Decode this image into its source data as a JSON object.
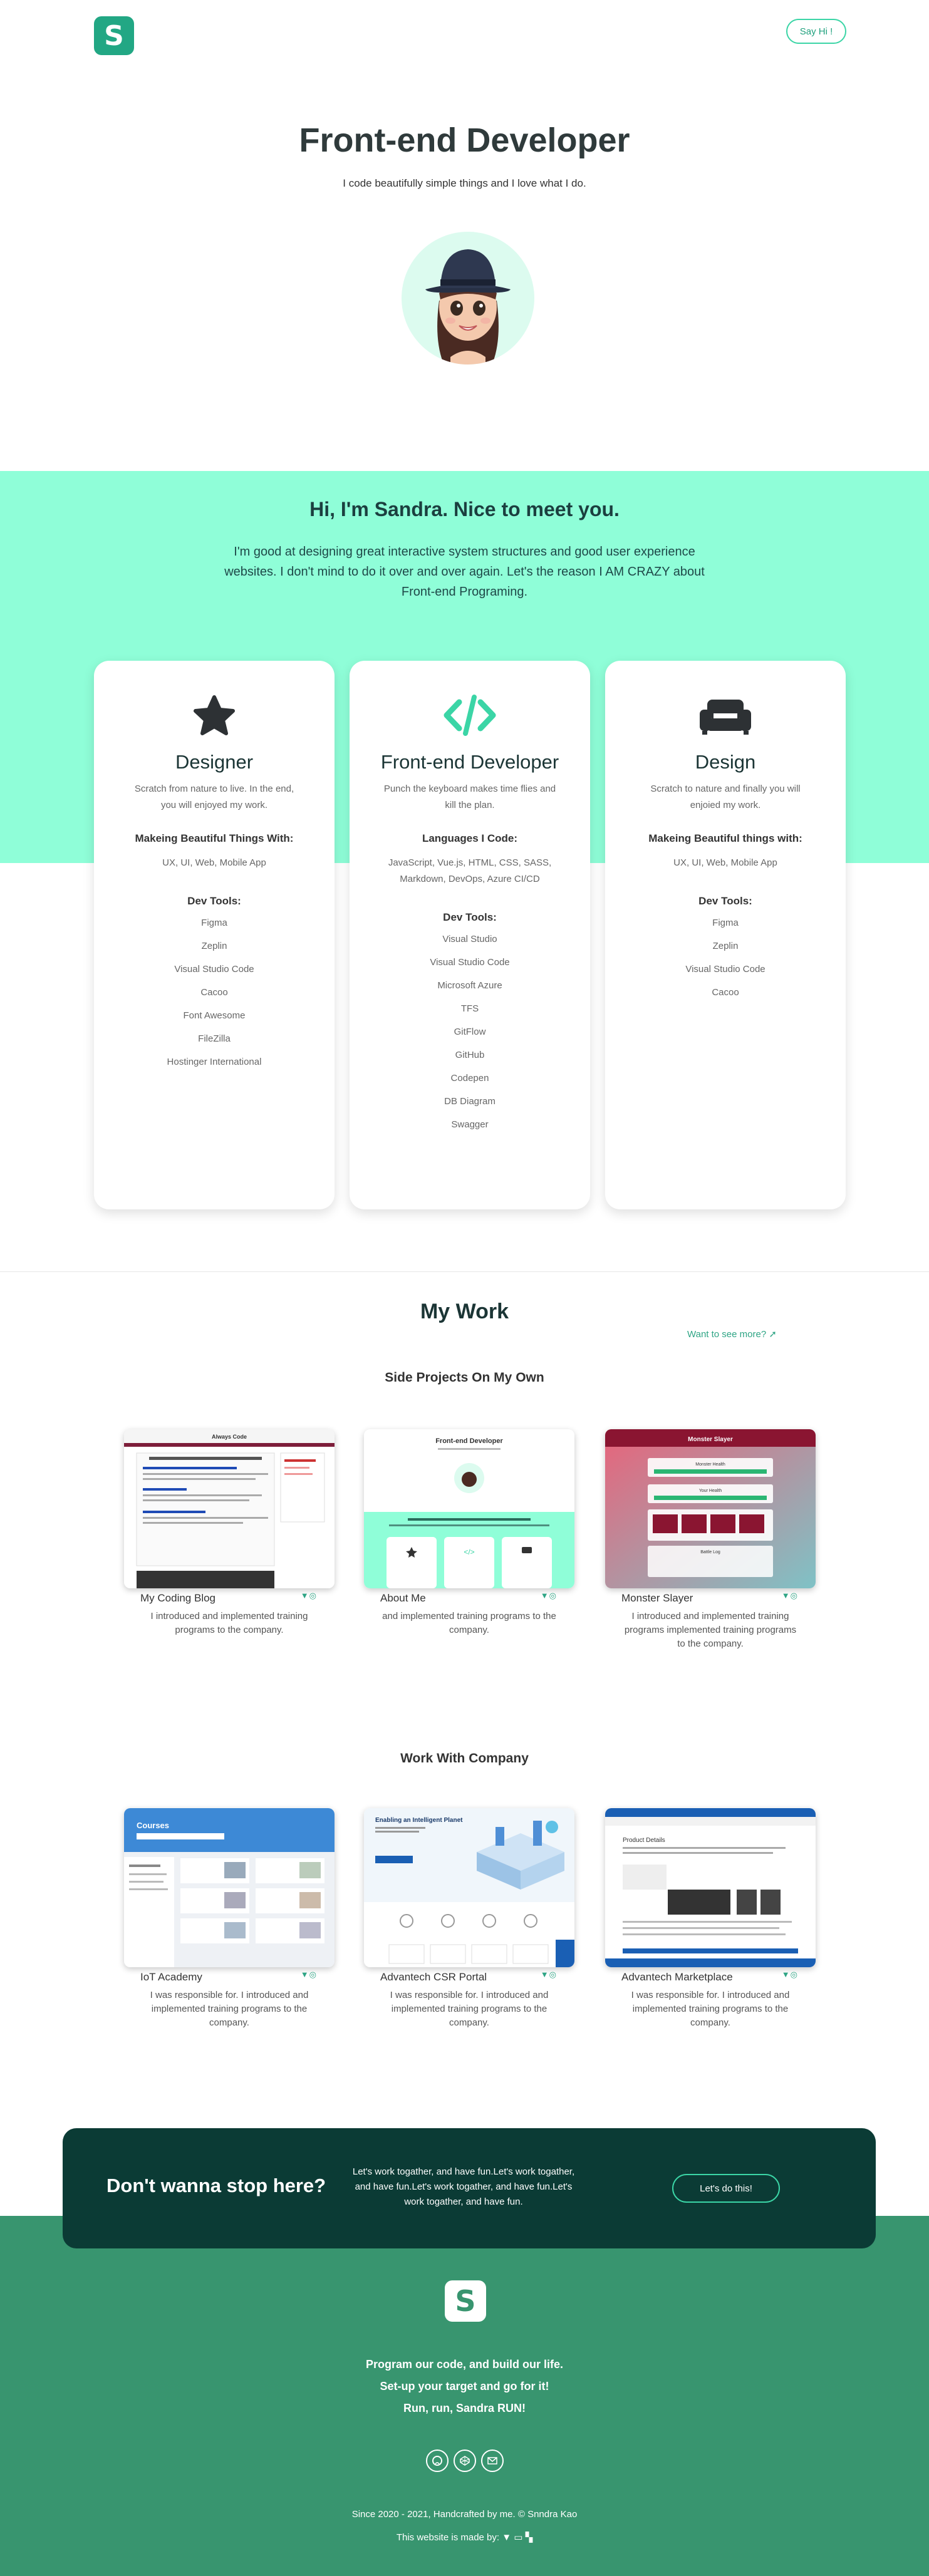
{
  "header": {
    "logo_letter": "S",
    "say_hi": "Say Hi !",
    "title": "Front-end Developer",
    "subtitle": "I code beautifully simple things and I love what I do."
  },
  "intro": {
    "heading": "Hi, I'm Sandra. Nice to meet you.",
    "text": "I'm good at designing great interactive system structures and good user experience websites. I don't mind to do it over and over again. Let's the reason I AM CRAZY about Front-end Programing."
  },
  "cards": [
    {
      "icon": "star-icon",
      "title": "Designer",
      "desc": "Scratch from nature to live. In the end, you will enjoyed my work.",
      "section": "Makeing Beautiful Things With:",
      "line": "UX, UI, Web, Mobile App",
      "tools_heading": "Dev Tools:",
      "tools": [
        "Figma",
        "Zeplin",
        "Visual Studio Code",
        "Cacoo",
        "Font Awesome",
        "FileZilla",
        "Hostinger International"
      ]
    },
    {
      "icon": "code-icon",
      "title": "Front-end Developer",
      "desc": "Punch the keyboard makes time flies and kill the plan.",
      "section": "Languages I Code:",
      "line": "JavaScript, Vue.js, HTML, CSS, SASS, Markdown, DevOps, Azure CI/CD",
      "tools_heading": "Dev Tools:",
      "tools": [
        "Visual Studio",
        "Visual Studio Code",
        "Microsoft Azure",
        "TFS",
        "GitFlow",
        "GitHub",
        "Codepen",
        "DB Diagram",
        "Swagger"
      ]
    },
    {
      "icon": "couch-icon",
      "title": "Design",
      "desc": "Scratch to nature and finally you will enjoied my work.",
      "section": "Makeing Beautiful things with:",
      "line": "UX, UI, Web, Mobile App",
      "tools_heading": "Dev Tools:",
      "tools": [
        "Figma",
        "Zeplin",
        "Visual Studio Code",
        "Cacoo"
      ]
    }
  ],
  "work": {
    "heading": "My Work",
    "want_more": "Want to see more?",
    "side_heading": "Side Projects On My Own",
    "company_heading": "Work With Company",
    "side_projects": [
      {
        "name": "My Coding Blog",
        "desc": "I introduced and implemented training programs to the company."
      },
      {
        "name": "About Me",
        "desc": "and implemented training programs to the company."
      },
      {
        "name": "Monster Slayer",
        "desc": "I introduced and implemented training programs implemented training programs to the company."
      }
    ],
    "company_projects": [
      {
        "name": "IoT Academy",
        "desc": "I was responsible for. I introduced and implemented training programs to the company."
      },
      {
        "name": "Advantech CSR Portal",
        "desc": "I was responsible for. I introduced and implemented training programs to the company."
      },
      {
        "name": "Advantech Marketplace",
        "desc": "I was responsible for. I introduced and implemented training programs to the company."
      }
    ],
    "shots": {
      "blog_title": "Always Code",
      "about_title": "Front-end Developer",
      "monster_title": "Monster Slayer",
      "monster_health": "Monster Health",
      "monster_your": "Your Health",
      "monster_log": "Battle Log",
      "iot_title": "Courses",
      "csr_title": "Enabling an Intelligent Planet",
      "market_title": "Product Details"
    }
  },
  "cta": {
    "heading": "Don't wanna stop here?",
    "text": "Let's work togather, and have fun.Let's work togather, and have fun.Let's work togather, and have fun.Let's work togather, and have fun.",
    "button": "Let's do this!"
  },
  "footer": {
    "logo_letter": "S",
    "line1": "Program our code, and build our life.",
    "line2": "Set-up your target and go for it!",
    "line3": "Run, run, Sandra RUN!",
    "copyright": "Since 2020 - 2021, Handcrafted by me. © Snndra Kao",
    "made_by": "This website is made by:"
  },
  "colors": {
    "mint": "#8ffed8",
    "green": "#38956f",
    "dark": "#0b3b35",
    "accent": "#22a784"
  }
}
